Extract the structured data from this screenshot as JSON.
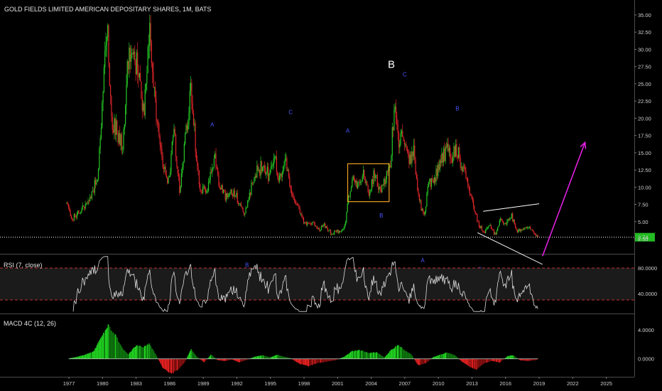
{
  "chart_data": {
    "type": "candlestick",
    "title": "GOLD FIELDS LIMITED AMERICAN DEPOSITARY SHARES, 1M, BATS",
    "price_axis": {
      "min": 0,
      "max": 36,
      "ticks": [
        "35.00",
        "32.50",
        "30.00",
        "27.50",
        "25.00",
        "22.50",
        "20.00",
        "17.50",
        "15.00",
        "12.50",
        "10.00",
        "7.50",
        "5.00",
        "2.50"
      ],
      "last_price_label": "2.74",
      "last_price": 2.74
    },
    "x_axis": {
      "range": [
        1976.3,
        2027.5
      ],
      "ticks": [
        "1977",
        "1980",
        "1983",
        "1986",
        "1989",
        "1992",
        "1995",
        "1998",
        "2001",
        "2004",
        "2007",
        "2010",
        "2013",
        "2016",
        "2019",
        "2022",
        "2025"
      ]
    },
    "price_path": [
      [
        1976.8,
        7.5
      ],
      [
        1977.2,
        5.2
      ],
      [
        1978.0,
        6.5
      ],
      [
        1979.0,
        8.5
      ],
      [
        1979.6,
        12.0
      ],
      [
        1980.4,
        34.5
      ],
      [
        1980.8,
        20.0
      ],
      [
        1981.3,
        18.0
      ],
      [
        1981.8,
        16.0
      ],
      [
        1982.2,
        26.0
      ],
      [
        1982.6,
        31.0
      ],
      [
        1983.0,
        28.0
      ],
      [
        1983.7,
        21.0
      ],
      [
        1984.2,
        33.5
      ],
      [
        1984.7,
        22.0
      ],
      [
        1985.3,
        14.0
      ],
      [
        1985.9,
        11.0
      ],
      [
        1986.4,
        18.0
      ],
      [
        1986.9,
        9.5
      ],
      [
        1987.4,
        17.0
      ],
      [
        1987.9,
        24.5
      ],
      [
        1988.4,
        14.0
      ],
      [
        1988.8,
        9.0
      ],
      [
        1989.5,
        10.5
      ],
      [
        1990.0,
        14.5
      ],
      [
        1990.4,
        10.5
      ],
      [
        1991.0,
        8.5
      ],
      [
        1991.5,
        9.5
      ],
      [
        1992.2,
        8.0
      ],
      [
        1992.6,
        6.0
      ],
      [
        1993.3,
        10.0
      ],
      [
        1993.8,
        12.5
      ],
      [
        1994.4,
        13.0
      ],
      [
        1994.9,
        11.5
      ],
      [
        1995.4,
        14.0
      ],
      [
        1995.8,
        11.0
      ],
      [
        1996.3,
        14.5
      ],
      [
        1996.8,
        10.0
      ],
      [
        1997.3,
        7.5
      ],
      [
        1997.8,
        5.5
      ],
      [
        1998.3,
        4.5
      ],
      [
        1998.8,
        5.0
      ],
      [
        1999.3,
        3.8
      ],
      [
        1999.8,
        4.5
      ],
      [
        2000.4,
        3.3
      ],
      [
        2000.9,
        3.5
      ],
      [
        2001.6,
        4.0
      ],
      [
        2002.0,
        8.5
      ],
      [
        2002.4,
        11.5
      ],
      [
        2002.8,
        10.0
      ],
      [
        2003.3,
        12.0
      ],
      [
        2003.8,
        9.5
      ],
      [
        2004.3,
        12.0
      ],
      [
        2004.8,
        9.5
      ],
      [
        2005.3,
        11.5
      ],
      [
        2005.7,
        13.0
      ],
      [
        2006.1,
        22.5
      ],
      [
        2006.5,
        16.0
      ],
      [
        2006.9,
        18.0
      ],
      [
        2007.4,
        14.0
      ],
      [
        2007.8,
        15.5
      ],
      [
        2008.2,
        9.0
      ],
      [
        2008.7,
        5.5
      ],
      [
        2009.1,
        10.5
      ],
      [
        2009.6,
        11.0
      ],
      [
        2010.2,
        13.5
      ],
      [
        2010.7,
        15.5
      ],
      [
        2011.2,
        14.0
      ],
      [
        2011.6,
        16.0
      ],
      [
        2012.1,
        13.0
      ],
      [
        2012.6,
        11.0
      ],
      [
        2013.1,
        7.5
      ],
      [
        2013.6,
        4.5
      ],
      [
        2014.1,
        3.5
      ],
      [
        2014.6,
        4.5
      ],
      [
        2015.1,
        3.0
      ],
      [
        2015.6,
        5.5
      ],
      [
        2016.0,
        4.5
      ],
      [
        2016.5,
        6.0
      ],
      [
        2017.0,
        3.5
      ],
      [
        2017.6,
        4.0
      ],
      [
        2018.1,
        4.0
      ],
      [
        2018.6,
        3.2
      ],
      [
        2018.9,
        2.74
      ]
    ],
    "annotations": [
      {
        "text": "A",
        "x": 1989.8,
        "y": 18.8,
        "size": "small"
      },
      {
        "text": "B",
        "x": 1992.9,
        "y": -1.6,
        "size": "small"
      },
      {
        "text": "C",
        "x": 1996.8,
        "y": 20.6,
        "size": "small"
      },
      {
        "text": "A",
        "x": 2001.9,
        "y": 17.9,
        "size": "small"
      },
      {
        "text": "B",
        "x": 2004.9,
        "y": 5.6,
        "size": "small"
      },
      {
        "text": "B",
        "x": 2005.8,
        "y": 27.3,
        "size": "big"
      },
      {
        "text": "C",
        "x": 2007.0,
        "y": 26.1,
        "size": "small"
      },
      {
        "text": "A",
        "x": 2008.6,
        "y": -0.9,
        "size": "small"
      },
      {
        "text": "B",
        "x": 2011.7,
        "y": 21.1,
        "size": "small"
      },
      {
        "text": "C",
        "x": 2013.7,
        "y": -2.2,
        "size": "small"
      }
    ],
    "consolidation_box": {
      "x0": 2001.9,
      "x1": 2005.6,
      "y0": 7.9,
      "y1": 13.4,
      "color": "#f0a020"
    },
    "wedge": {
      "upper": [
        [
          2014.0,
          6.5
        ],
        [
          2019.0,
          7.6
        ]
      ],
      "lower": [
        [
          2013.5,
          3.4
        ],
        [
          2019.3,
          -1.2
        ]
      ],
      "color": "#ffffff"
    },
    "target_arrow": {
      "from": [
        2019.3,
        0.0
      ],
      "to": [
        2023.1,
        16.5
      ],
      "color": "#e020e0"
    },
    "rsi": {
      "label": "RSI (7, close)",
      "range": [
        10,
        100
      ],
      "levels": [
        80,
        30
      ],
      "ticks": [
        "80.0000",
        "40.0000"
      ],
      "line_color": "#dddddd",
      "band_color": "#1b1b1b",
      "level_color": "#c03030"
    },
    "macd": {
      "label": "MACD 4C (12, 26)",
      "range": [
        -2.3,
        6.0
      ],
      "ticks": [
        "4.0000",
        "0.0000"
      ],
      "profile": [
        [
          1977.0,
          0.05
        ],
        [
          1977.8,
          0.3
        ],
        [
          1978.5,
          0.6
        ],
        [
          1979.2,
          1.0
        ],
        [
          1979.8,
          2.8
        ],
        [
          1980.5,
          4.6
        ],
        [
          1981.2,
          3.2
        ],
        [
          1981.8,
          1.4
        ],
        [
          1982.3,
          0.6
        ],
        [
          1983.0,
          1.9
        ],
        [
          1983.6,
          1.6
        ],
        [
          1984.2,
          2.1
        ],
        [
          1984.8,
          0.5
        ],
        [
          1985.4,
          -1.3
        ],
        [
          1986.1,
          -2.1
        ],
        [
          1986.7,
          -1.6
        ],
        [
          1987.3,
          -0.6
        ],
        [
          1987.9,
          1.3
        ],
        [
          1988.5,
          0.2
        ],
        [
          1989.1,
          -0.5
        ],
        [
          1989.7,
          0.6
        ],
        [
          1990.3,
          -0.2
        ],
        [
          1991.0,
          -0.3
        ],
        [
          1991.6,
          -0.1
        ],
        [
          1992.2,
          -0.5
        ],
        [
          1992.8,
          -0.2
        ],
        [
          1993.6,
          0.3
        ],
        [
          1994.3,
          0.5
        ],
        [
          1995.0,
          0.2
        ],
        [
          1995.6,
          0.6
        ],
        [
          1996.2,
          0.3
        ],
        [
          1996.8,
          0.1
        ],
        [
          1997.6,
          -0.7
        ],
        [
          1998.4,
          -1.0
        ],
        [
          1999.2,
          -0.6
        ],
        [
          2000.0,
          -0.4
        ],
        [
          2000.8,
          -0.2
        ],
        [
          2001.6,
          0.3
        ],
        [
          2002.3,
          1.1
        ],
        [
          2003.0,
          1.2
        ],
        [
          2003.8,
          0.8
        ],
        [
          2004.5,
          0.9
        ],
        [
          2005.2,
          0.2
        ],
        [
          2005.8,
          1.3
        ],
        [
          2006.4,
          1.9
        ],
        [
          2007.0,
          1.2
        ],
        [
          2007.6,
          0.6
        ],
        [
          2008.2,
          -0.9
        ],
        [
          2008.9,
          -0.6
        ],
        [
          2009.5,
          0.2
        ],
        [
          2010.2,
          0.6
        ],
        [
          2010.8,
          0.9
        ],
        [
          2011.5,
          0.5
        ],
        [
          2012.1,
          -0.4
        ],
        [
          2012.8,
          -1.1
        ],
        [
          2013.4,
          -1.5
        ],
        [
          2014.0,
          -0.7
        ],
        [
          2014.8,
          -0.3
        ],
        [
          2015.5,
          -0.5
        ],
        [
          2016.2,
          0.4
        ],
        [
          2016.7,
          0.5
        ],
        [
          2017.3,
          -0.2
        ],
        [
          2018.0,
          -0.3
        ],
        [
          2018.6,
          -0.2
        ],
        [
          2018.9,
          -0.1
        ]
      ]
    }
  }
}
